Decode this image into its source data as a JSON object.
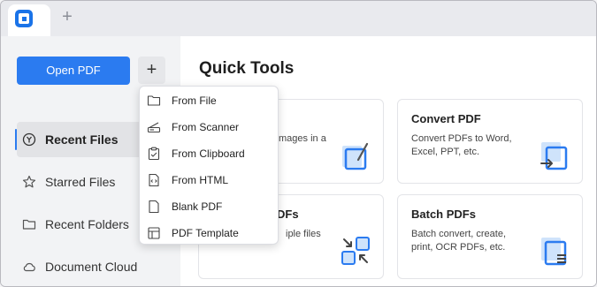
{
  "tabs": {
    "new_tab_symbol": "+"
  },
  "sidebar": {
    "open_pdf_label": "Open PDF",
    "plus_symbol": "+",
    "items": [
      {
        "label": "Recent Files",
        "icon": "recent-files-icon",
        "active": true
      },
      {
        "label": "Starred Files",
        "icon": "star-icon",
        "active": false
      },
      {
        "label": "Recent Folders",
        "icon": "folder-icon",
        "active": false
      },
      {
        "label": "Document Cloud",
        "icon": "cloud-icon",
        "active": false
      }
    ]
  },
  "main": {
    "title": "Quick Tools",
    "cards": [
      {
        "title": "",
        "desc": "mages in a",
        "icon": "image-to-pdf-icon"
      },
      {
        "title": "Convert PDF",
        "desc": "Convert PDFs to Word, Excel, PPT, etc.",
        "icon": "convert-pdf-icon"
      },
      {
        "title": "DFs",
        "desc": "iple files",
        "icon": "combine-pdfs-icon"
      },
      {
        "title": "Batch PDFs",
        "desc": "Batch convert, create, print, OCR PDFs, etc.",
        "icon": "batch-pdfs-icon"
      }
    ]
  },
  "menu": {
    "items": [
      {
        "label": "From File",
        "icon": "folder-icon"
      },
      {
        "label": "From Scanner",
        "icon": "scanner-icon"
      },
      {
        "label": "From Clipboard",
        "icon": "clipboard-icon"
      },
      {
        "label": "From HTML",
        "icon": "html-file-icon"
      },
      {
        "label": "Blank PDF",
        "icon": "blank-page-icon"
      },
      {
        "label": "PDF Template",
        "icon": "template-icon"
      }
    ]
  },
  "colors": {
    "accent": "#2b7bf0",
    "logo": "#1a73e8"
  }
}
